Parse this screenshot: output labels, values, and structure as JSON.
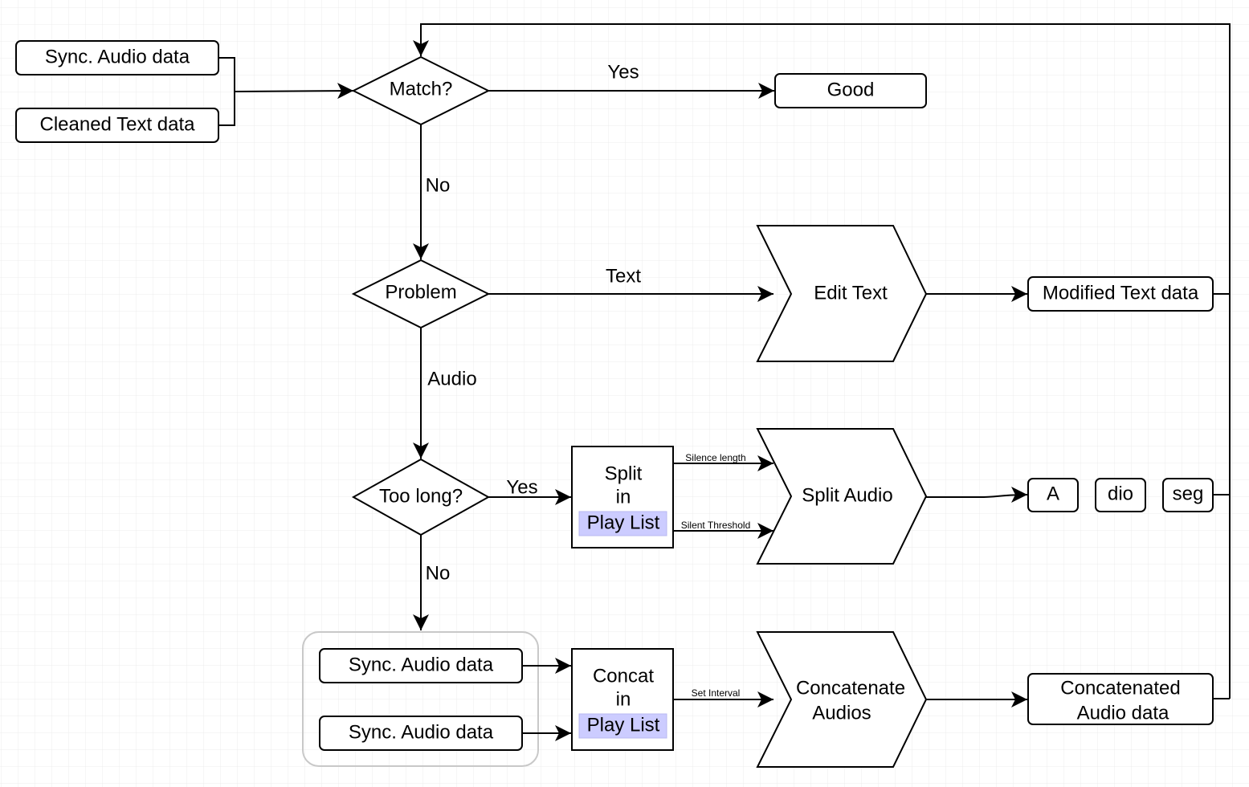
{
  "colors": {
    "stroke": "#000000",
    "grid": "#e6e6e6",
    "highlight": "#ccccff",
    "group_border": "#c8c8c8"
  },
  "inputs": {
    "sync_audio": "Sync. Audio data",
    "cleaned_text": "Cleaned Text data"
  },
  "decisions": {
    "match": "Match?",
    "problem": "Problem",
    "too_long": "Too long?"
  },
  "edges": {
    "yes1": "Yes",
    "no1": "No",
    "text": "Text",
    "audio": "Audio",
    "yes2": "Yes",
    "no2": "No",
    "silence_length": "Silence length",
    "silent_threshold": "Silent Threshold",
    "set_interval": "Set Interval"
  },
  "outputs": {
    "good": "Good",
    "modified_text": "Modified Text data",
    "seg_a": "A",
    "seg_dio": "dio",
    "seg_seg": "seg",
    "concatenated_1": "Concatenated",
    "concatenated_2": "Audio data"
  },
  "processes": {
    "edit_text": "Edit Text",
    "split_audio": "Split Audio",
    "concat_1": "Concatenate",
    "concat_2": "Audios"
  },
  "playlist": {
    "split": "Split",
    "in": "in",
    "play_list": "Play List",
    "concat": "Concat"
  },
  "group": {
    "sync_audio_1": "Sync. Audio data",
    "sync_audio_2": "Sync. Audio data"
  }
}
